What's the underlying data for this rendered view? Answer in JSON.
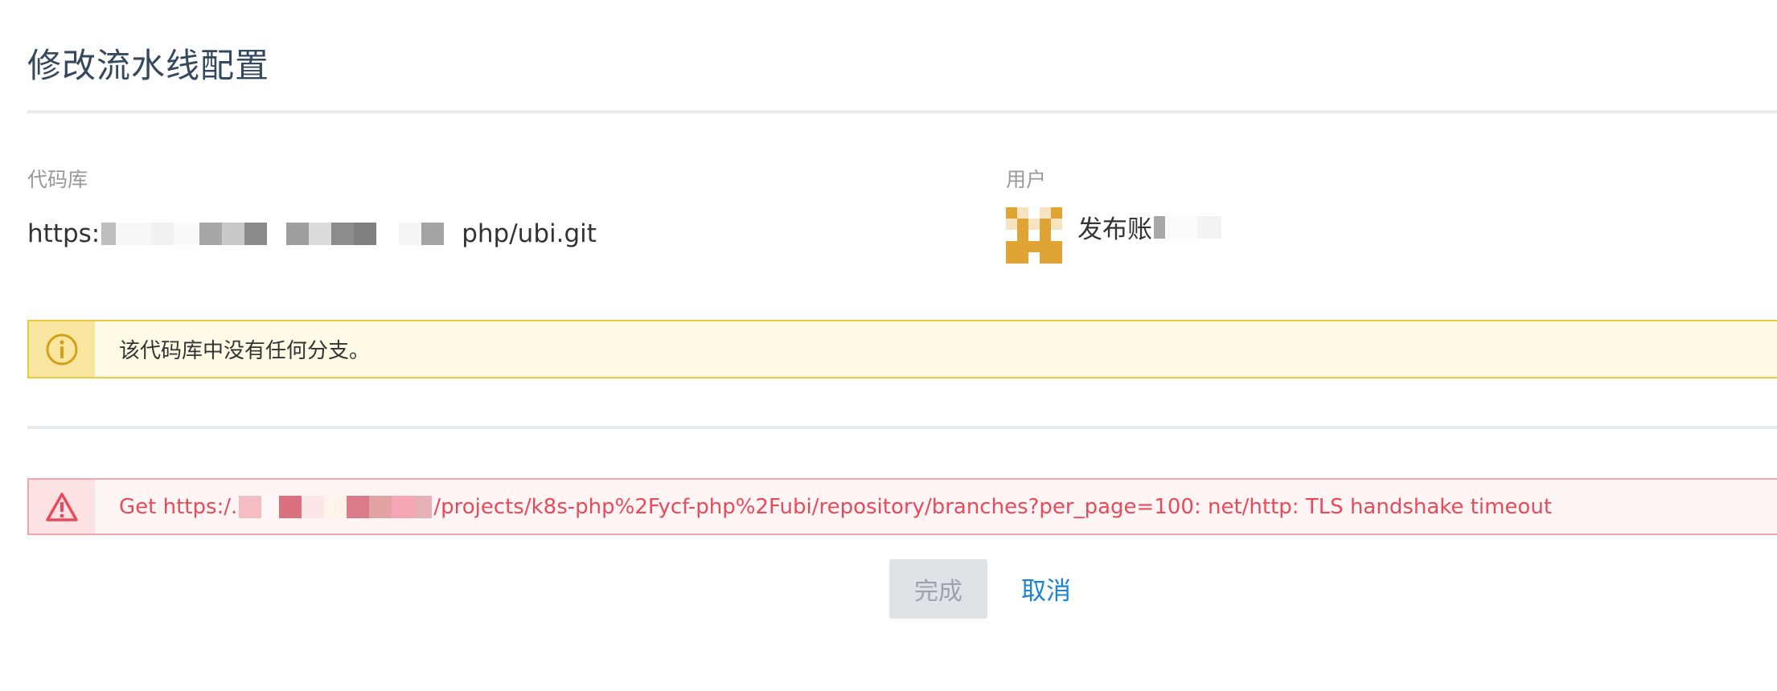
{
  "page": {
    "title": "修改流水线配置"
  },
  "repository": {
    "label": "代码库",
    "url_prefix": "https:",
    "url_suffix": "php/ubi.git"
  },
  "user": {
    "label": "用户",
    "name_visible": "发布账"
  },
  "warning_alert": {
    "icon": "info-circle-icon",
    "message": "该代码库中没有任何分支。"
  },
  "error_alert": {
    "icon": "warning-triangle-icon",
    "message_prefix": "Get https:/.",
    "message_suffix": "/projects/k8s-php%2Fycf-php%2Fubi/repository/branches?per_page=100: net/http: TLS handshake timeout"
  },
  "actions": {
    "done_label": "完成",
    "cancel_label": "取消"
  },
  "colors": {
    "warning_border": "#e8c940",
    "warning_icon": "#d4a017",
    "error_border": "#f0a6ad",
    "error_text": "#e84a5a",
    "link": "#1a84d0",
    "avatar": "#e0a435"
  }
}
